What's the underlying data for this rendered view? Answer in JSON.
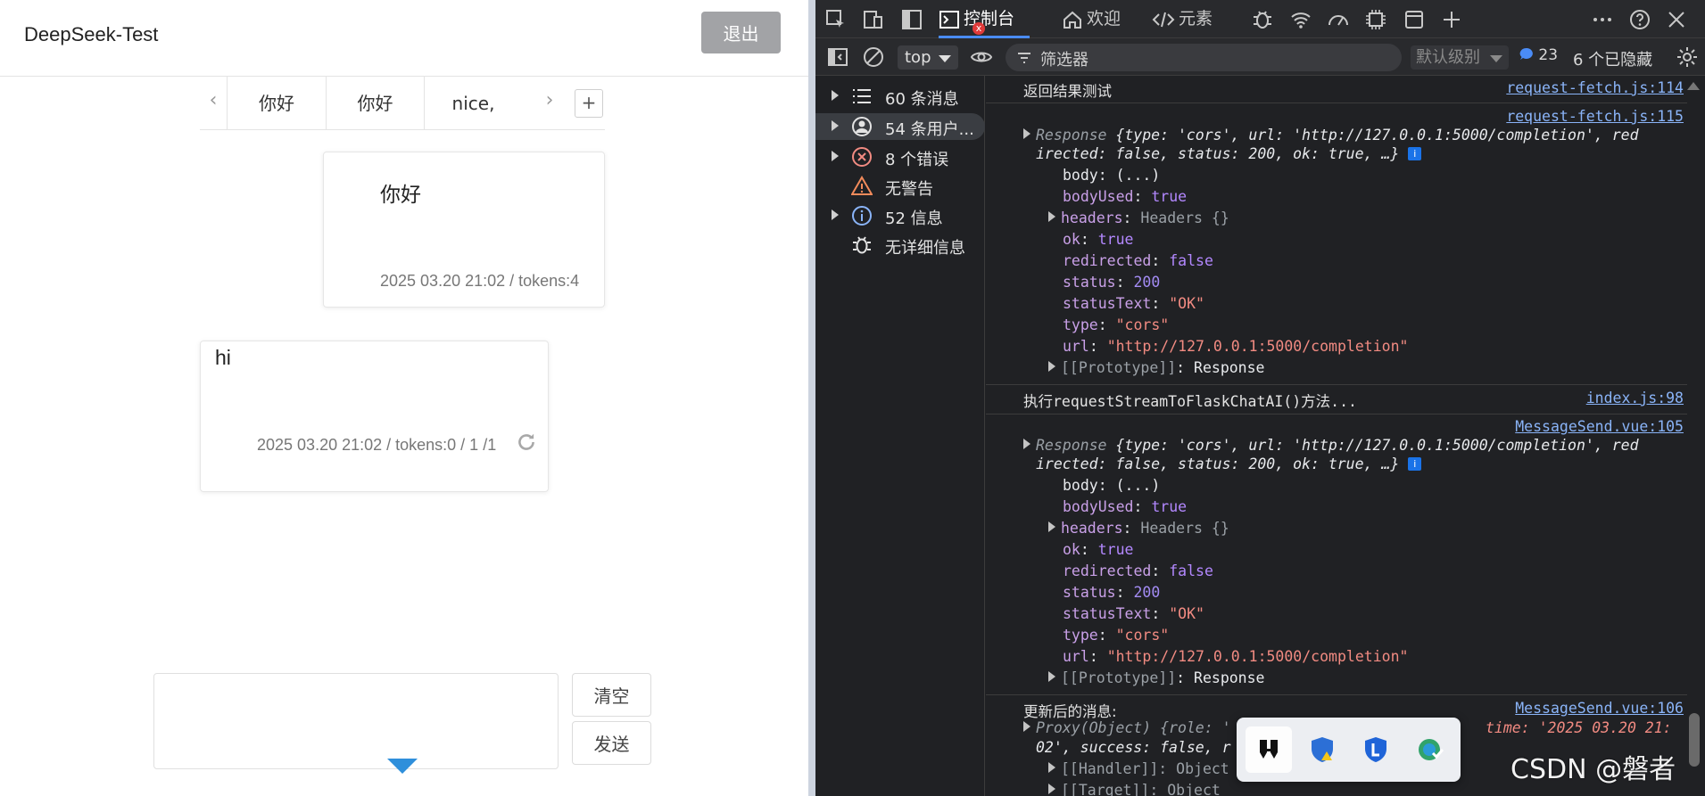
{
  "app": {
    "title": "DeepSeek-Test",
    "logout_label": "退出",
    "tabs": [
      "你好",
      "你好",
      "nice,"
    ],
    "add_tab_label": "+",
    "prev_arrow": "‹",
    "next_arrow": "›",
    "messages": [
      {
        "role": "user",
        "text": "你好",
        "meta": "2025 03.20 21:02 / tokens:4"
      },
      {
        "role": "assistant",
        "text": "hi",
        "meta": "2025 03.20 21:02 / tokens:0 / 1 /1"
      }
    ],
    "clear_label": "清空",
    "send_label": "发送"
  },
  "devtools": {
    "tabs": {
      "console": "控制台",
      "welcome": "欢迎",
      "elements": "元素"
    },
    "console_badge": "x",
    "context": "top",
    "filter_placeholder": "筛选器",
    "level": "默认级别",
    "message_count": "23",
    "hidden": "6 个已隐藏",
    "sidebar": [
      {
        "label": "60 条消息",
        "icon": "list-icon"
      },
      {
        "label": "54 条用户...",
        "icon": "user-icon"
      },
      {
        "label": "8 个错误",
        "icon": "error-icon"
      },
      {
        "label": "无警告",
        "icon": "warning-icon"
      },
      {
        "label": "52 信息",
        "icon": "info-icon"
      },
      {
        "label": "无详细信息",
        "icon": "bug-icon"
      }
    ],
    "console": {
      "log1_text": "返回结果测试",
      "log1_src": "request-fetch.js:114",
      "log2_src": "request-fetch.js:115",
      "resp_head_a": "Response ",
      "resp_obj_a": "{type: 'cors', url: 'http://127.0.0.1:5000/completion', red",
      "resp_obj_b": "irected: false, status: 200, ok: true, …}",
      "body": "body: (...)",
      "bodyUsed_key": "bodyUsed",
      "bodyUsed_val": "true",
      "headers_key": "headers",
      "headers_val": "Headers {}",
      "ok_key": "ok",
      "ok_val": "true",
      "redirected_key": "redirected",
      "redirected_val": "false",
      "status_key": "status",
      "status_val": "200",
      "statusText_key": "statusText",
      "statusText_val": "\"OK\"",
      "type_key": "type",
      "type_val": "\"cors\"",
      "url_key": "url",
      "url_val": "\"http://127.0.0.1:5000/completion\"",
      "proto_key": "[[Prototype]]",
      "proto_val": "Response",
      "log3_text": "执行requestStreamToFlaskChatAI()方法...",
      "log3_src": "index.js:98",
      "log4_src": "MessageSend.vue:105",
      "log5_text": "更新后的消息:",
      "log5_src": "MessageSend.vue:106",
      "proxy_a": "Proxy(Object) {role: '",
      "proxy_a2": "time: '2025 03.20 21:",
      "proxy_b": "02', success: false, r",
      "handler": "[[Handler]]: Object",
      "target": "[[Target]]: Object"
    }
  },
  "watermark": "CSDN @磐者"
}
